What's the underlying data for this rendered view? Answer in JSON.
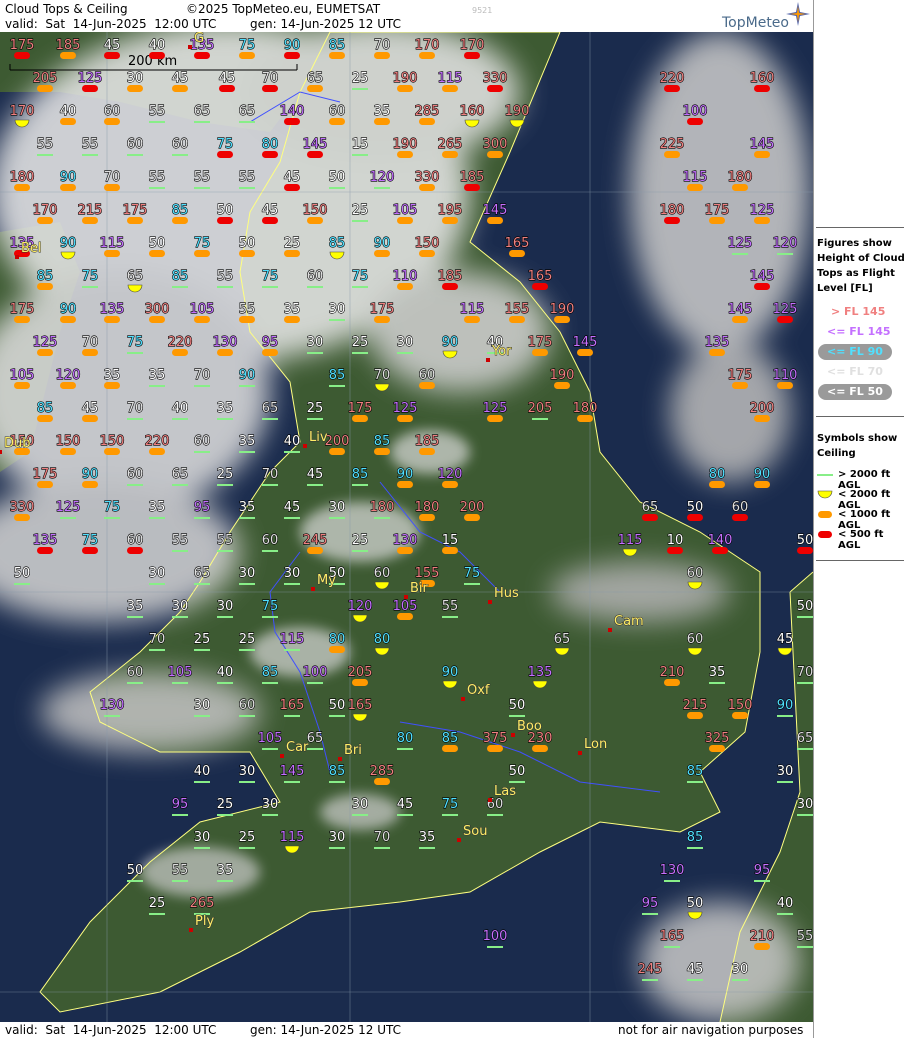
{
  "header": {
    "title": "Cloud Tops & Ceiling",
    "copyright": "©2025 TopMeteo.eu, EUMETSAT",
    "valid": "valid:  Sat  14-Jun-2025  12:00 UTC",
    "gen": "gen: 14-Jun-2025 12 UTC",
    "code": "9521",
    "logo": "TopMeteo"
  },
  "footer": {
    "valid": "valid:  Sat  14-Jun-2025  12:00 UTC",
    "gen": "gen: 14-Jun-2025 12 UTC",
    "note": "not for air navigation purposes"
  },
  "scale_label": "200 km",
  "colors": {
    "red": "#f08080",
    "purple": "#c470ff",
    "cyan": "#50e0ff",
    "white": "#ffffff",
    "grey": "#e0e0e0",
    "sym_green": "#88ee88",
    "sym_yellow": "#ffff00",
    "sym_orange": "#ff9900",
    "sym_red": "#ee0000",
    "sea": "#1a2b4d",
    "land": "#3d5a32",
    "coast": "#ffff80",
    "border": "#4050ff"
  },
  "legend": {
    "figures_title": [
      "Figures show",
      "Height of Cloud",
      "Tops as Flight",
      "Level  [FL]"
    ],
    "fl_items": [
      {
        "label": "> FL 145",
        "color": "#f08080"
      },
      {
        "label": "<= FL 145",
        "color": "#c470ff"
      },
      {
        "label": "<= FL 90",
        "color": "#50e0ff"
      },
      {
        "label": "<= FL 70",
        "color": "#e0e0e0"
      },
      {
        "label": "<= FL 50",
        "color": "#ffffff"
      }
    ],
    "symbols_title": [
      "Symbols show",
      "Ceiling"
    ],
    "sym_items": [
      {
        "label": "> 2000 ft AGL",
        "sym": "G"
      },
      {
        "label": "< 2000 ft AGL",
        "sym": "Y"
      },
      {
        "label": "< 1000 ft AGL",
        "sym": "O"
      },
      {
        "label": "< 500 ft AGL",
        "sym": "R"
      }
    ]
  },
  "cities": [
    {
      "name": "Yor"
    },
    {
      "name": "Liv"
    },
    {
      "name": "Hus"
    },
    {
      "name": "Bir"
    },
    {
      "name": "Cam"
    },
    {
      "name": "Oxf"
    },
    {
      "name": "Boo"
    },
    {
      "name": "Lon"
    },
    {
      "name": "Las"
    },
    {
      "name": "Sou"
    },
    {
      "name": "Bri"
    },
    {
      "name": "Car"
    },
    {
      "name": "Ply"
    },
    {
      "name": "My"
    },
    {
      "name": "Bel"
    },
    {
      "name": "G"
    },
    {
      "name": "Dub"
    }
  ],
  "stations": [
    {
      "fl": "175",
      "sym": "R"
    },
    {
      "fl": "185",
      "sym": "O"
    },
    {
      "fl": "45",
      "sym": "R"
    },
    {
      "fl": "40",
      "sym": "R"
    },
    {
      "fl": "135",
      "sym": "R"
    },
    {
      "fl": "75",
      "sym": "O"
    },
    {
      "fl": "90",
      "sym": "R"
    },
    {
      "fl": "85",
      "sym": "O"
    },
    {
      "fl": "70",
      "sym": "O"
    },
    {
      "fl": "170",
      "sym": "O"
    },
    {
      "fl": "170",
      "sym": "R"
    },
    {
      "fl": "205",
      "sym": "O"
    },
    {
      "fl": "125",
      "sym": "R"
    },
    {
      "fl": "30",
      "sym": "O"
    },
    {
      "fl": "45",
      "sym": "O"
    },
    {
      "fl": "45",
      "sym": "R"
    },
    {
      "fl": "70",
      "sym": "R"
    },
    {
      "fl": "65",
      "sym": "O"
    },
    {
      "fl": "25",
      "sym": "G"
    },
    {
      "fl": "190",
      "sym": "O"
    },
    {
      "fl": "115",
      "sym": "O"
    },
    {
      "fl": "330",
      "sym": "R"
    },
    {
      "fl": "220",
      "sym": "R"
    },
    {
      "fl": "160",
      "sym": "R"
    },
    {
      "fl": "170",
      "sym": "Y"
    },
    {
      "fl": "40",
      "sym": "O"
    },
    {
      "fl": "60",
      "sym": "O"
    },
    {
      "fl": "55",
      "sym": "G"
    },
    {
      "fl": "65",
      "sym": "G"
    },
    {
      "fl": "65",
      "sym": "G"
    },
    {
      "fl": "140",
      "sym": "R"
    },
    {
      "fl": "60",
      "sym": "O"
    },
    {
      "fl": "35",
      "sym": "O"
    },
    {
      "fl": "285",
      "sym": "O"
    },
    {
      "fl": "160",
      "sym": "Y"
    },
    {
      "fl": "190",
      "sym": "Y"
    },
    {
      "fl": "100",
      "sym": "R"
    },
    {
      "fl": "55",
      "sym": "G"
    },
    {
      "fl": "55",
      "sym": "G"
    },
    {
      "fl": "60",
      "sym": "G"
    },
    {
      "fl": "60",
      "sym": "G"
    },
    {
      "fl": "75",
      "sym": "R"
    },
    {
      "fl": "80",
      "sym": "R"
    },
    {
      "fl": "145",
      "sym": "R"
    },
    {
      "fl": "15",
      "sym": "G"
    },
    {
      "fl": "190",
      "sym": "O"
    },
    {
      "fl": "265",
      "sym": "O"
    },
    {
      "fl": "300",
      "sym": "O"
    },
    {
      "fl": "225",
      "sym": "O"
    },
    {
      "fl": "145",
      "sym": "O"
    },
    {
      "fl": "180",
      "sym": "O"
    },
    {
      "fl": "90",
      "sym": "O"
    },
    {
      "fl": "70",
      "sym": "O"
    },
    {
      "fl": "55",
      "sym": "G"
    },
    {
      "fl": "55",
      "sym": "G"
    },
    {
      "fl": "55",
      "sym": "G"
    },
    {
      "fl": "45",
      "sym": "R"
    },
    {
      "fl": "50",
      "sym": "G"
    },
    {
      "fl": "120",
      "sym": "G"
    },
    {
      "fl": "330",
      "sym": "O"
    },
    {
      "fl": "185",
      "sym": "R"
    },
    {
      "fl": "115",
      "sym": "O"
    },
    {
      "fl": "180",
      "sym": "O"
    },
    {
      "fl": "170",
      "sym": "O"
    },
    {
      "fl": "215",
      "sym": "O"
    },
    {
      "fl": "175",
      "sym": "O"
    },
    {
      "fl": "85",
      "sym": "O"
    },
    {
      "fl": "50",
      "sym": "R"
    },
    {
      "fl": "45",
      "sym": "R"
    },
    {
      "fl": "150",
      "sym": "O"
    },
    {
      "fl": "25",
      "sym": "G"
    },
    {
      "fl": "105",
      "sym": "O"
    },
    {
      "fl": "195",
      "sym": "O"
    },
    {
      "fl": "145",
      "sym": "O"
    },
    {
      "fl": "180",
      "sym": "R"
    },
    {
      "fl": "175",
      "sym": "O"
    },
    {
      "fl": "125",
      "sym": "O"
    },
    {
      "fl": "135",
      "sym": "R"
    },
    {
      "fl": "90",
      "sym": "Y"
    },
    {
      "fl": "115",
      "sym": "O"
    },
    {
      "fl": "50",
      "sym": "O"
    },
    {
      "fl": "75",
      "sym": "O"
    },
    {
      "fl": "50",
      "sym": "O"
    },
    {
      "fl": "25",
      "sym": "O"
    },
    {
      "fl": "85",
      "sym": "Y"
    },
    {
      "fl": "90",
      "sym": "O"
    },
    {
      "fl": "150",
      "sym": "O"
    },
    {
      "fl": "165",
      "sym": "O"
    },
    {
      "fl": "125",
      "sym": "G"
    },
    {
      "fl": "120",
      "sym": "G"
    },
    {
      "fl": "85",
      "sym": "O"
    },
    {
      "fl": "75",
      "sym": "G"
    },
    {
      "fl": "65",
      "sym": "Y"
    },
    {
      "fl": "85",
      "sym": "G"
    },
    {
      "fl": "55",
      "sym": "G"
    },
    {
      "fl": "75",
      "sym": "G"
    },
    {
      "fl": "60",
      "sym": "G"
    },
    {
      "fl": "75",
      "sym": "G"
    },
    {
      "fl": "110",
      "sym": "O"
    },
    {
      "fl": "185",
      "sym": "R"
    },
    {
      "fl": "165",
      "sym": "R"
    },
    {
      "fl": "145",
      "sym": "R"
    },
    {
      "fl": "175",
      "sym": "O"
    },
    {
      "fl": "90",
      "sym": "O"
    },
    {
      "fl": "135",
      "sym": "O"
    },
    {
      "fl": "300",
      "sym": "O"
    },
    {
      "fl": "105",
      "sym": "O"
    },
    {
      "fl": "55",
      "sym": "O"
    },
    {
      "fl": "35",
      "sym": "O"
    },
    {
      "fl": "30",
      "sym": "G"
    },
    {
      "fl": "175",
      "sym": "O"
    },
    {
      "fl": "115",
      "sym": "O"
    },
    {
      "fl": "155",
      "sym": "O"
    },
    {
      "fl": "190",
      "sym": "O"
    },
    {
      "fl": "145",
      "sym": "O"
    },
    {
      "fl": "125",
      "sym": "R"
    },
    {
      "fl": "125",
      "sym": "O"
    },
    {
      "fl": "70",
      "sym": "O"
    },
    {
      "fl": "75",
      "sym": "G"
    },
    {
      "fl": "220",
      "sym": "O"
    },
    {
      "fl": "130",
      "sym": "O"
    },
    {
      "fl": "95",
      "sym": "O"
    },
    {
      "fl": "30",
      "sym": "G"
    },
    {
      "fl": "25",
      "sym": "G"
    },
    {
      "fl": "30",
      "sym": "G"
    },
    {
      "fl": "90",
      "sym": "Y"
    },
    {
      "fl": "40",
      "sym": "G"
    },
    {
      "fl": "175",
      "sym": "O"
    },
    {
      "fl": "145",
      "sym": "O"
    },
    {
      "fl": "135",
      "sym": "O"
    },
    {
      "fl": "105",
      "sym": "O"
    },
    {
      "fl": "120",
      "sym": "O"
    },
    {
      "fl": "35",
      "sym": "O"
    },
    {
      "fl": "35",
      "sym": "G"
    },
    {
      "fl": "70",
      "sym": "G"
    },
    {
      "fl": "90",
      "sym": "G"
    },
    {
      "fl": "85",
      "sym": "G"
    },
    {
      "fl": "70",
      "sym": "Y"
    },
    {
      "fl": "60",
      "sym": "O"
    },
    {
      "fl": "190",
      "sym": "O"
    },
    {
      "fl": "175",
      "sym": "O"
    },
    {
      "fl": "110",
      "sym": "O"
    },
    {
      "fl": "85",
      "sym": "O"
    },
    {
      "fl": "45",
      "sym": "O"
    },
    {
      "fl": "70",
      "sym": "G"
    },
    {
      "fl": "40",
      "sym": "G"
    },
    {
      "fl": "35",
      "sym": "G"
    },
    {
      "fl": "65",
      "sym": "G"
    },
    {
      "fl": "25",
      "sym": "G"
    },
    {
      "fl": "175",
      "sym": "O"
    },
    {
      "fl": "125",
      "sym": "O"
    },
    {
      "fl": "125",
      "sym": "O"
    },
    {
      "fl": "205",
      "sym": "G"
    },
    {
      "fl": "180",
      "sym": "O"
    },
    {
      "fl": "200",
      "sym": "O"
    },
    {
      "fl": "150",
      "sym": "O"
    },
    {
      "fl": "150",
      "sym": "O"
    },
    {
      "fl": "150",
      "sym": "O"
    },
    {
      "fl": "220",
      "sym": "O"
    },
    {
      "fl": "60",
      "sym": "G"
    },
    {
      "fl": "35",
      "sym": "G"
    },
    {
      "fl": "40",
      "sym": "G"
    },
    {
      "fl": "200",
      "sym": "O"
    },
    {
      "fl": "85",
      "sym": "O"
    },
    {
      "fl": "185",
      "sym": "O"
    },
    {
      "fl": "175",
      "sym": "O"
    },
    {
      "fl": "90",
      "sym": "O"
    },
    {
      "fl": "60",
      "sym": "G"
    },
    {
      "fl": "65",
      "sym": "G"
    },
    {
      "fl": "25",
      "sym": "G"
    },
    {
      "fl": "70",
      "sym": "G"
    },
    {
      "fl": "45",
      "sym": "G"
    },
    {
      "fl": "85",
      "sym": "G"
    },
    {
      "fl": "90",
      "sym": "O"
    },
    {
      "fl": "120",
      "sym": "O"
    },
    {
      "fl": "80",
      "sym": "O"
    },
    {
      "fl": "90",
      "sym": "O"
    },
    {
      "fl": "330",
      "sym": "O"
    },
    {
      "fl": "125",
      "sym": "G"
    },
    {
      "fl": "75",
      "sym": "G"
    },
    {
      "fl": "35",
      "sym": "G"
    },
    {
      "fl": "95",
      "sym": "G"
    },
    {
      "fl": "35",
      "sym": "G"
    },
    {
      "fl": "45",
      "sym": "G"
    },
    {
      "fl": "30",
      "sym": "G"
    },
    {
      "fl": "180",
      "sym": "G"
    },
    {
      "fl": "180",
      "sym": "O"
    },
    {
      "fl": "200",
      "sym": "O"
    },
    {
      "fl": "65",
      "sym": "R"
    },
    {
      "fl": "50",
      "sym": "R"
    },
    {
      "fl": "60",
      "sym": "R"
    },
    {
      "fl": "135",
      "sym": "R"
    },
    {
      "fl": "75",
      "sym": "R"
    },
    {
      "fl": "60",
      "sym": "R"
    },
    {
      "fl": "55",
      "sym": "G"
    },
    {
      "fl": "55",
      "sym": "G"
    },
    {
      "fl": "60",
      "sym": "G"
    },
    {
      "fl": "245",
      "sym": "O"
    },
    {
      "fl": "25",
      "sym": "G"
    },
    {
      "fl": "130",
      "sym": "O"
    },
    {
      "fl": "15",
      "sym": "O"
    },
    {
      "fl": "115",
      "sym": "Y"
    },
    {
      "fl": "10",
      "sym": "R"
    },
    {
      "fl": "140",
      "sym": "R"
    },
    {
      "fl": "50",
      "sym": "R"
    },
    {
      "fl": "50",
      "sym": "G"
    },
    {
      "fl": "30",
      "sym": "G"
    },
    {
      "fl": "65",
      "sym": "G"
    },
    {
      "fl": "30",
      "sym": "G"
    },
    {
      "fl": "30",
      "sym": "G"
    },
    {
      "fl": "50",
      "sym": "G"
    },
    {
      "fl": "60",
      "sym": "Y"
    },
    {
      "fl": "155",
      "sym": "O"
    },
    {
      "fl": "75",
      "sym": "G"
    },
    {
      "fl": "60",
      "sym": "Y"
    },
    {
      "fl": "35",
      "sym": "G"
    },
    {
      "fl": "30",
      "sym": "G"
    },
    {
      "fl": "30",
      "sym": "G"
    },
    {
      "fl": "75",
      "sym": "G"
    },
    {
      "fl": "120",
      "sym": "Y"
    },
    {
      "fl": "105",
      "sym": "O"
    },
    {
      "fl": "55",
      "sym": "G"
    },
    {
      "fl": "50",
      "sym": "G"
    },
    {
      "fl": "70",
      "sym": "G"
    },
    {
      "fl": "25",
      "sym": "G"
    },
    {
      "fl": "25",
      "sym": "G"
    },
    {
      "fl": "115",
      "sym": "G"
    },
    {
      "fl": "80",
      "sym": "O"
    },
    {
      "fl": "80",
      "sym": "Y"
    },
    {
      "fl": "65",
      "sym": "Y"
    },
    {
      "fl": "60",
      "sym": "Y"
    },
    {
      "fl": "45",
      "sym": "Y"
    },
    {
      "fl": "60",
      "sym": "G"
    },
    {
      "fl": "105",
      "sym": "G"
    },
    {
      "fl": "40",
      "sym": "G"
    },
    {
      "fl": "85",
      "sym": "G"
    },
    {
      "fl": "100",
      "sym": "G"
    },
    {
      "fl": "205",
      "sym": "O"
    },
    {
      "fl": "90",
      "sym": "Y"
    },
    {
      "fl": "135",
      "sym": "Y"
    },
    {
      "fl": "210",
      "sym": "O"
    },
    {
      "fl": "35",
      "sym": "G"
    },
    {
      "fl": "70",
      "sym": "G"
    },
    {
      "fl": "130",
      "sym": "G"
    },
    {
      "fl": "30",
      "sym": "G"
    },
    {
      "fl": "60",
      "sym": "G"
    },
    {
      "fl": "165",
      "sym": "G"
    },
    {
      "fl": "50",
      "sym": "G"
    },
    {
      "fl": "50",
      "sym": "G"
    },
    {
      "fl": "165",
      "sym": "Y"
    },
    {
      "fl": "215",
      "sym": "O"
    },
    {
      "fl": "150",
      "sym": "O"
    },
    {
      "fl": "90",
      "sym": "G"
    },
    {
      "fl": "105",
      "sym": "G"
    },
    {
      "fl": "65",
      "sym": "G"
    },
    {
      "fl": "80",
      "sym": "G"
    },
    {
      "fl": "85",
      "sym": "O"
    },
    {
      "fl": "375",
      "sym": "O"
    },
    {
      "fl": "230",
      "sym": "O"
    },
    {
      "fl": "325",
      "sym": "O"
    },
    {
      "fl": "65",
      "sym": "G"
    },
    {
      "fl": "40",
      "sym": "G"
    },
    {
      "fl": "30",
      "sym": "G"
    },
    {
      "fl": "145",
      "sym": "G"
    },
    {
      "fl": "85",
      "sym": "G"
    },
    {
      "fl": "285",
      "sym": "O"
    },
    {
      "fl": "50",
      "sym": "G"
    },
    {
      "fl": "85",
      "sym": "G"
    },
    {
      "fl": "30",
      "sym": "G"
    },
    {
      "fl": "95",
      "sym": "G"
    },
    {
      "fl": "25",
      "sym": "G"
    },
    {
      "fl": "30",
      "sym": "G"
    },
    {
      "fl": "30",
      "sym": "G"
    },
    {
      "fl": "45",
      "sym": "G"
    },
    {
      "fl": "75",
      "sym": "G"
    },
    {
      "fl": "60",
      "sym": "G"
    },
    {
      "fl": "30",
      "sym": "G"
    },
    {
      "fl": "30",
      "sym": "G"
    },
    {
      "fl": "25",
      "sym": "G"
    },
    {
      "fl": "115",
      "sym": "Y"
    },
    {
      "fl": "30",
      "sym": "G"
    },
    {
      "fl": "70",
      "sym": "G"
    },
    {
      "fl": "35",
      "sym": "G"
    },
    {
      "fl": "85",
      "sym": "G"
    },
    {
      "fl": "50",
      "sym": "G"
    },
    {
      "fl": "55",
      "sym": "G"
    },
    {
      "fl": "35",
      "sym": "G"
    },
    {
      "fl": "130",
      "sym": "G"
    },
    {
      "fl": "95",
      "sym": "G"
    },
    {
      "fl": "25",
      "sym": "G"
    },
    {
      "fl": "265",
      "sym": "G"
    },
    {
      "fl": "95",
      "sym": "G"
    },
    {
      "fl": "50",
      "sym": "Y"
    },
    {
      "fl": "40",
      "sym": "G"
    },
    {
      "fl": "100",
      "sym": "G"
    },
    {
      "fl": "165",
      "sym": "G"
    },
    {
      "fl": "210",
      "sym": "O"
    },
    {
      "fl": "55",
      "sym": "G"
    },
    {
      "fl": "245",
      "sym": "G"
    },
    {
      "fl": "45",
      "sym": "G"
    },
    {
      "fl": "30",
      "sym": "G"
    }
  ]
}
